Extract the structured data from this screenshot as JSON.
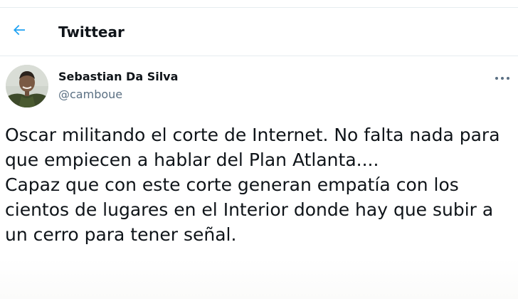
{
  "header": {
    "title": "Twittear",
    "back_icon": "arrow-left-icon",
    "accent_color": "#1da1f2"
  },
  "tweet": {
    "author": {
      "name": "Sebastian Da Silva",
      "handle": "@camboue"
    },
    "more_icon": "more-horizontal-icon",
    "lines": [
      "Oscar militando el corte de Internet. No falta nada para",
      "que empiecen a hablar del Plan Atlanta....",
      "Capaz que con este corte generan empatía con los",
      "cientos de lugares en el Interior donde hay que subir a",
      "un cerro para tener señal."
    ]
  }
}
